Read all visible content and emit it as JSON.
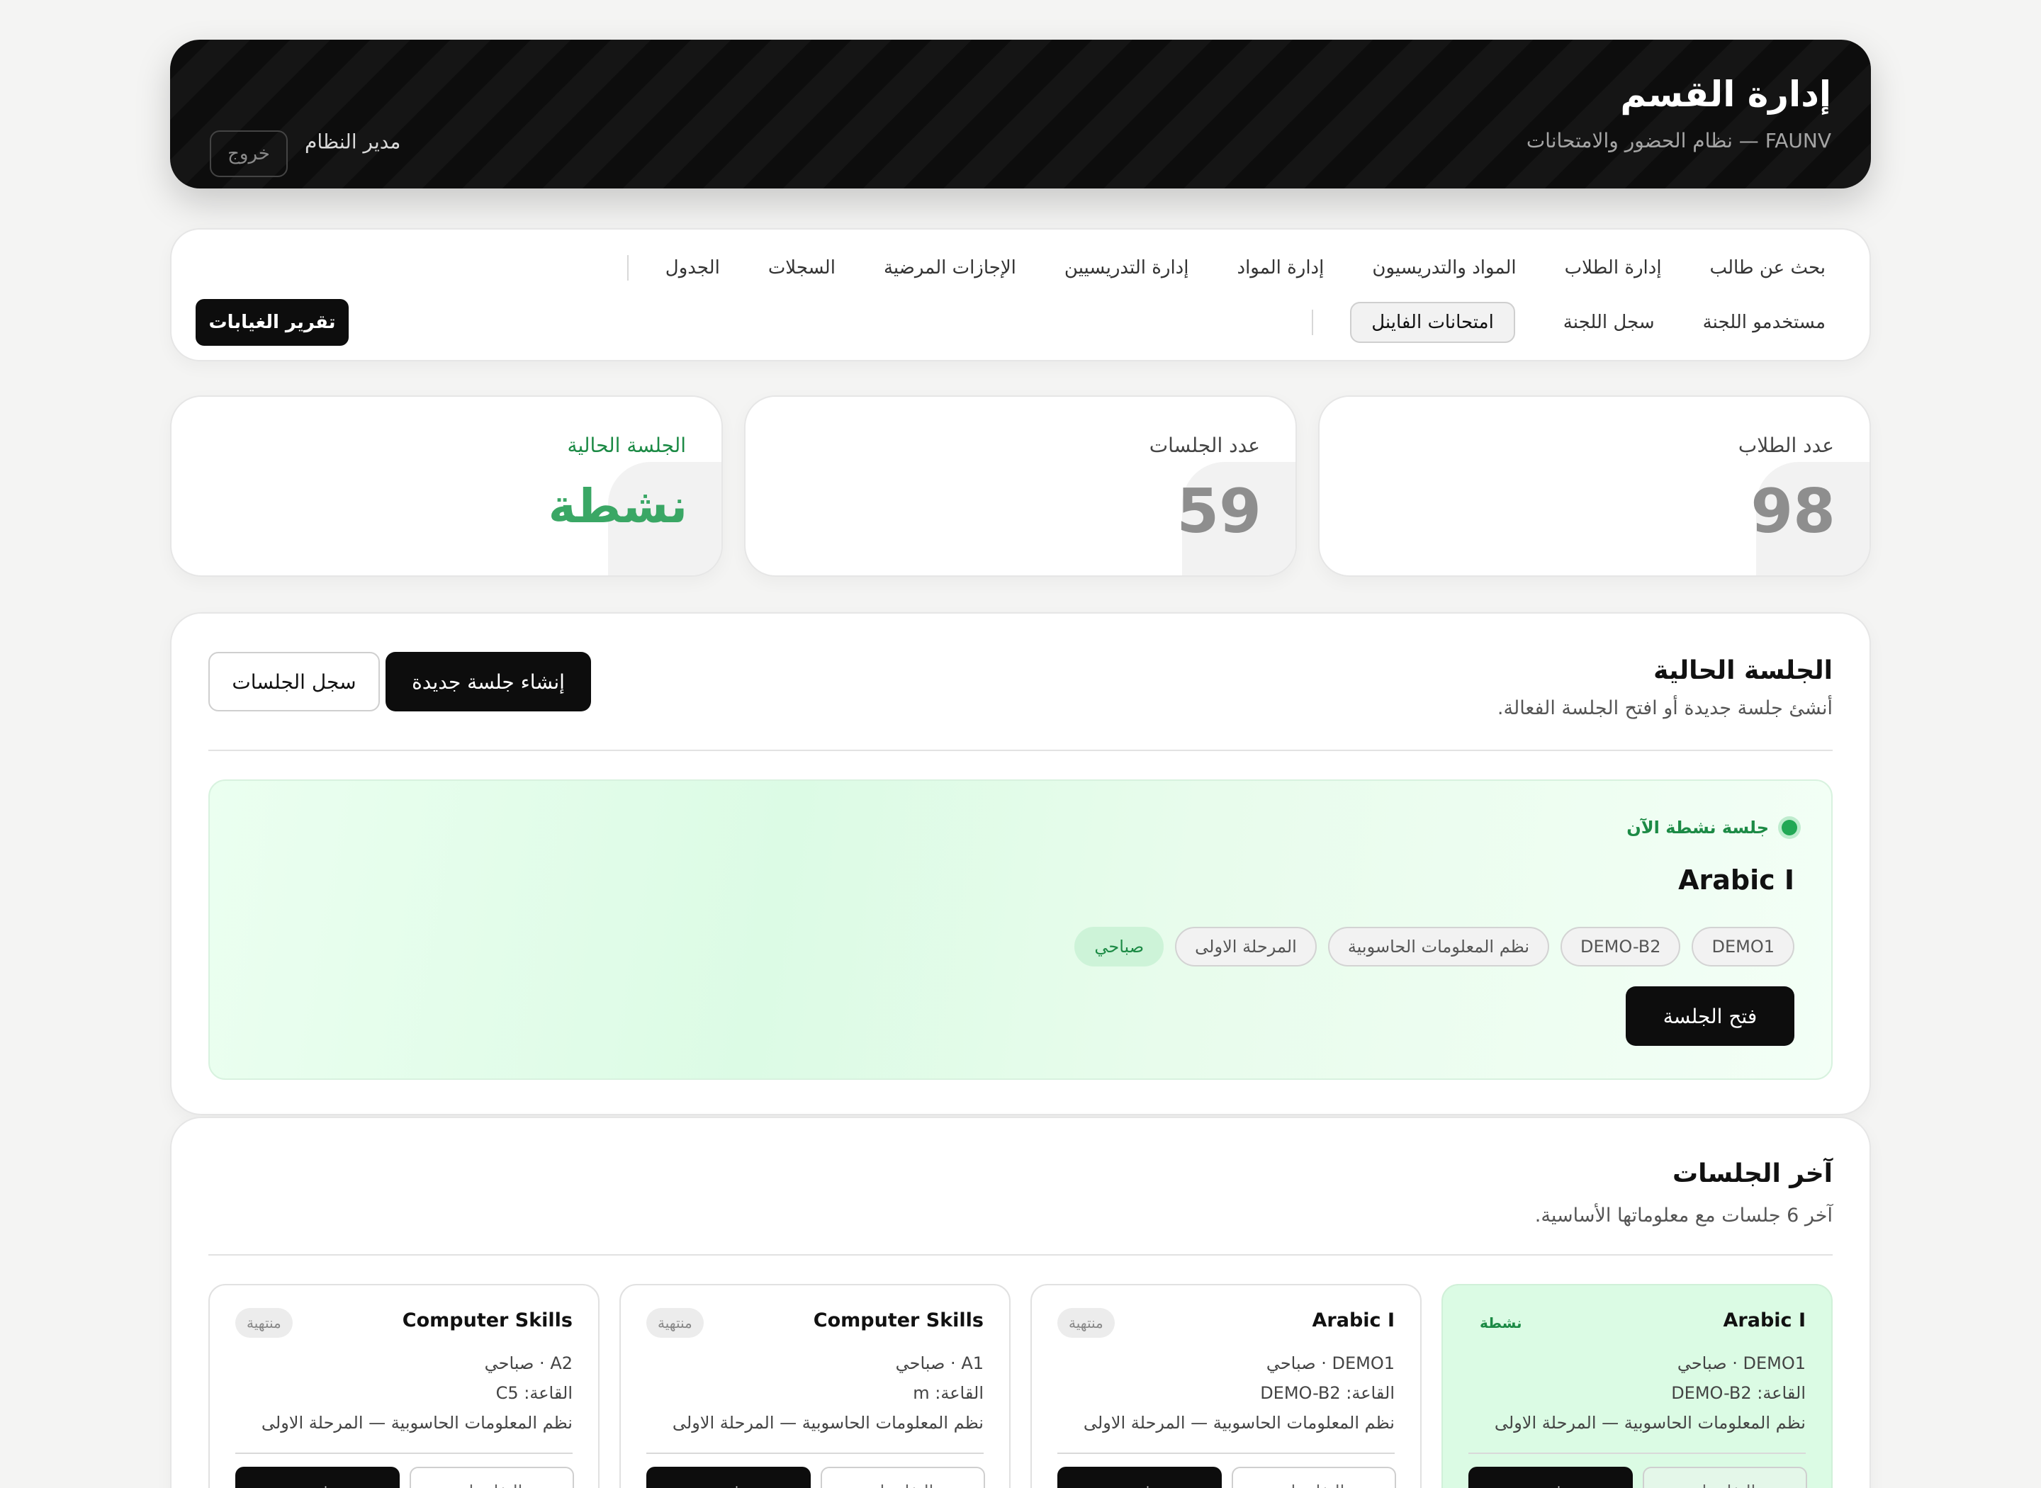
{
  "header": {
    "title": "إدارة القسم",
    "subtitle": "FAUNV — نظام الحضور والامتحانات",
    "user": "مدير النظام",
    "logout": "خروج"
  },
  "nav": {
    "row1": [
      "بحث عن طالب",
      "إدارة الطلاب",
      "المواد والتدريسيون",
      "إدارة المواد",
      "إدارة التدريسيين",
      "الإجازات المرضية",
      "السجلات",
      "الجدول"
    ],
    "row2": [
      "مستخدمو اللجنة",
      "سجل اللجنة",
      "امتحانات الفاينل"
    ],
    "active_item": "امتحانات الفاينل",
    "report_button": "تقرير الغيابات"
  },
  "stats": {
    "students": {
      "label": "عدد الطلاب",
      "value": "98"
    },
    "sessions": {
      "label": "عدد الجلسات",
      "value": "59"
    },
    "current": {
      "label": "الجلسة الحالية",
      "value": "نشطة"
    }
  },
  "current_session": {
    "title": "الجلسة الحالية",
    "subtitle": "أنشئ جلسة جديدة أو افتح الجلسة الفعالة.",
    "create_button": "إنشاء جلسة جديدة",
    "log_button": "سجل الجلسات",
    "live_label": "جلسة نشطة الآن",
    "course": "Arabic I",
    "chips": [
      "DEMO1",
      "DEMO-B2",
      "نظم المعلومات الحاسوبية",
      "المرحلة الاولى",
      "صباحي"
    ],
    "open_button": "فتح الجلسة"
  },
  "recent": {
    "title": "آخر الجلسات",
    "subtitle": "آخر 6 جلسات مع معلوماتها الأساسية.",
    "cards": [
      {
        "name": "Arabic I",
        "status": "نشطة",
        "line1": "DEMO1 · صباحي",
        "line2": "القاعة: DEMO-B2",
        "line3": "نظم المعلومات الحاسوبية — المرحلة الاولى",
        "open": "فتح",
        "details": "التفاصيل"
      },
      {
        "name": "Arabic I",
        "status": "منتهية",
        "line1": "DEMO1 · صباحي",
        "line2": "القاعة: DEMO-B2",
        "line3": "نظم المعلومات الحاسوبية — المرحلة الاولى",
        "open": "فتح",
        "details": "التفاصيل"
      },
      {
        "name": "Computer Skills",
        "status": "منتهية",
        "line1": "A1 · صباحي",
        "line2": "القاعة: m",
        "line3": "نظم المعلومات الحاسوبية — المرحلة الاولى",
        "open": "فتح",
        "details": "التفاصيل"
      },
      {
        "name": "Computer Skills",
        "status": "منتهية",
        "line1": "A2 · صباحي",
        "line2": "القاعة: C5",
        "line3": "نظم المعلومات الحاسوبية — المرحلة الاولى",
        "open": "فتح",
        "details": "التفاصيل"
      }
    ]
  },
  "colors": {
    "accent_green": "#1c8a45",
    "dark": "#0d0d0d",
    "active_bg": "#dbfbe4"
  }
}
